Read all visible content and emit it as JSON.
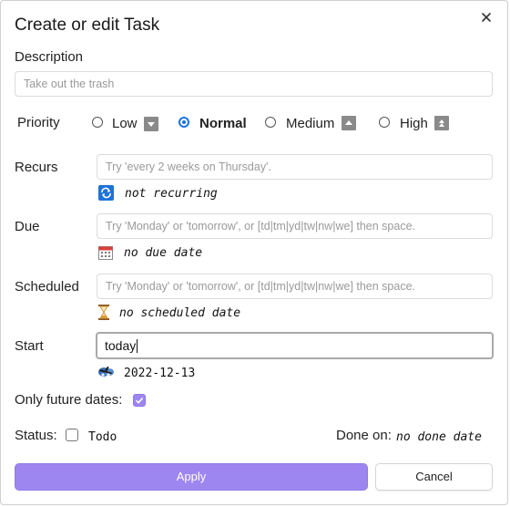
{
  "dialog": {
    "title": "Create or edit Task"
  },
  "description": {
    "label": "Description",
    "placeholder": "Take out the trash"
  },
  "priority": {
    "label": "Priority",
    "selected": "Normal",
    "options": [
      {
        "label": "Low",
        "icon": "arrow-down-icon"
      },
      {
        "label": "Normal",
        "icon": ""
      },
      {
        "label": "Medium",
        "icon": "arrow-up-icon"
      },
      {
        "label": "High",
        "icon": "double-arrow-up-icon"
      }
    ]
  },
  "recurs": {
    "label": "Recurs",
    "placeholder": "Try 'every 2 weeks on Thursday'.",
    "status": "not recurring",
    "icon": "repeat-icon"
  },
  "due": {
    "label": "Due",
    "placeholder": "Try 'Monday' or 'tomorrow', or [td|tm|yd|tw|nw|we] then space.",
    "status": "no due date",
    "icon": "calendar-icon"
  },
  "scheduled": {
    "label": "Scheduled",
    "placeholder": "Try 'Monday' or 'tomorrow', or [td|tm|yd|tw|nw|we] then space.",
    "status": "no scheduled date",
    "icon": "hourglass-icon"
  },
  "start": {
    "label": "Start",
    "value": "today",
    "status": "2022-12-13",
    "icon": "flight-departure-icon"
  },
  "future": {
    "label": "Only future dates:",
    "checked": true
  },
  "status": {
    "label": "Status:",
    "value": "Todo",
    "checked": false
  },
  "done": {
    "label": "Done on:",
    "value": "no done date"
  },
  "buttons": {
    "apply": "Apply",
    "cancel": "Cancel"
  },
  "colors": {
    "accent": "#9e86f0",
    "radio": "#1a73e8",
    "recurIcon": "#1e73d8"
  }
}
